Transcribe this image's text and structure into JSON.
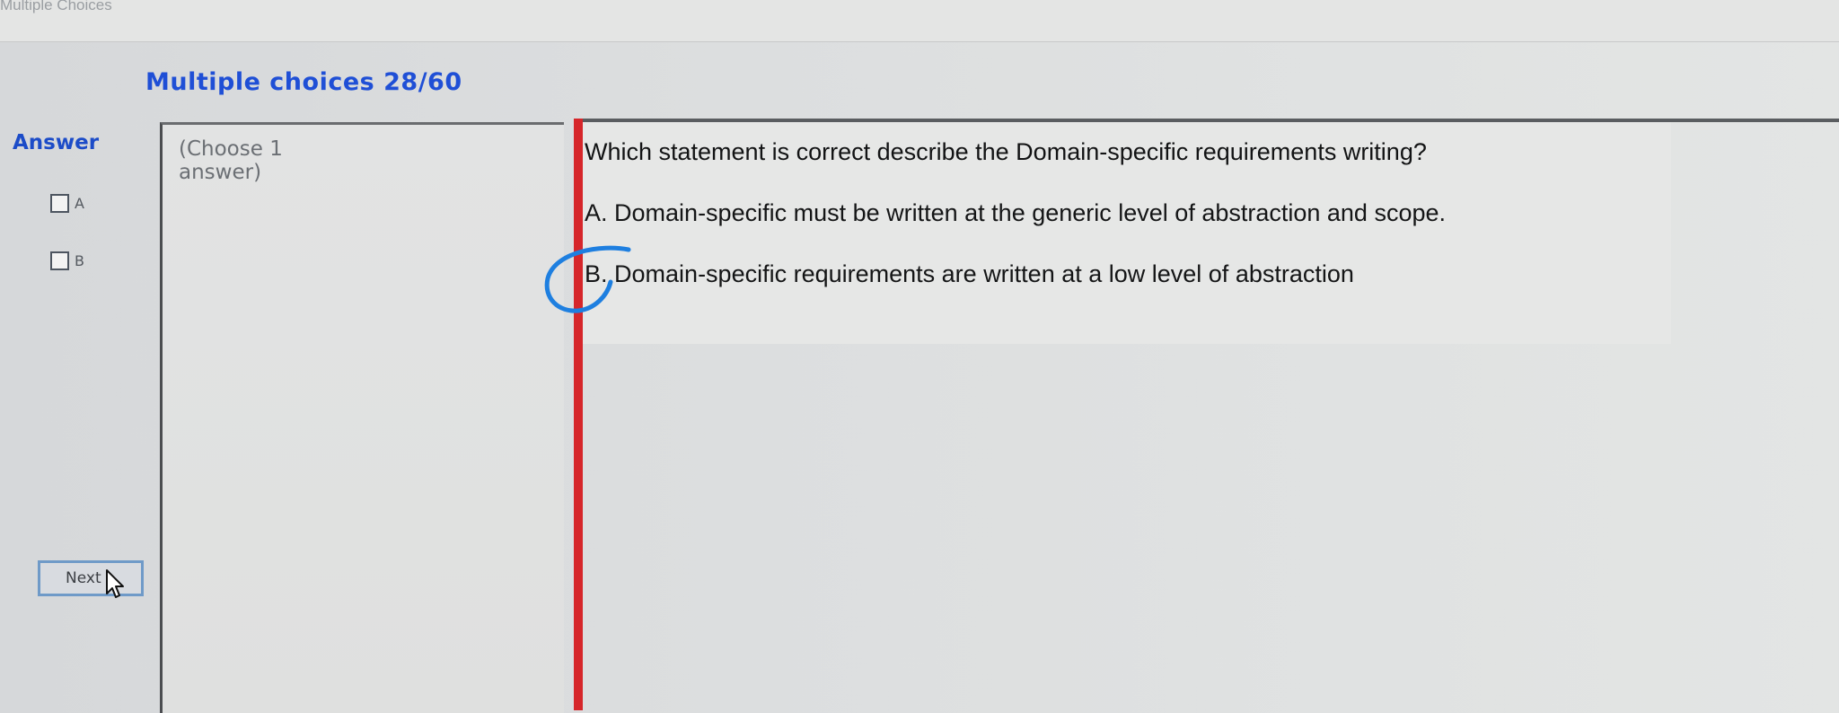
{
  "window": {
    "title": "Multiple Choices"
  },
  "header": {
    "title": "Multiple choices 28/60"
  },
  "answer_panel": {
    "heading": "Answer",
    "options": [
      {
        "label": "A",
        "checked": false
      },
      {
        "label": "B",
        "checked": false
      }
    ],
    "next_button_label": "Next"
  },
  "instruction": {
    "text": "(Choose 1 answer)"
  },
  "question": {
    "text": "Which statement is correct describe the Domain-specific requirements writing?",
    "choices": [
      {
        "letter": "A.",
        "text": "Domain-specific must be written at the generic level of abstraction and scope."
      },
      {
        "letter": "B.",
        "text": "Domain-specific requirements are written at a low level of abstraction"
      }
    ]
  },
  "colors": {
    "title_blue": "#1f4fd6",
    "divider_red": "#d6262a",
    "pen_annotation": "#1e7fe0"
  }
}
